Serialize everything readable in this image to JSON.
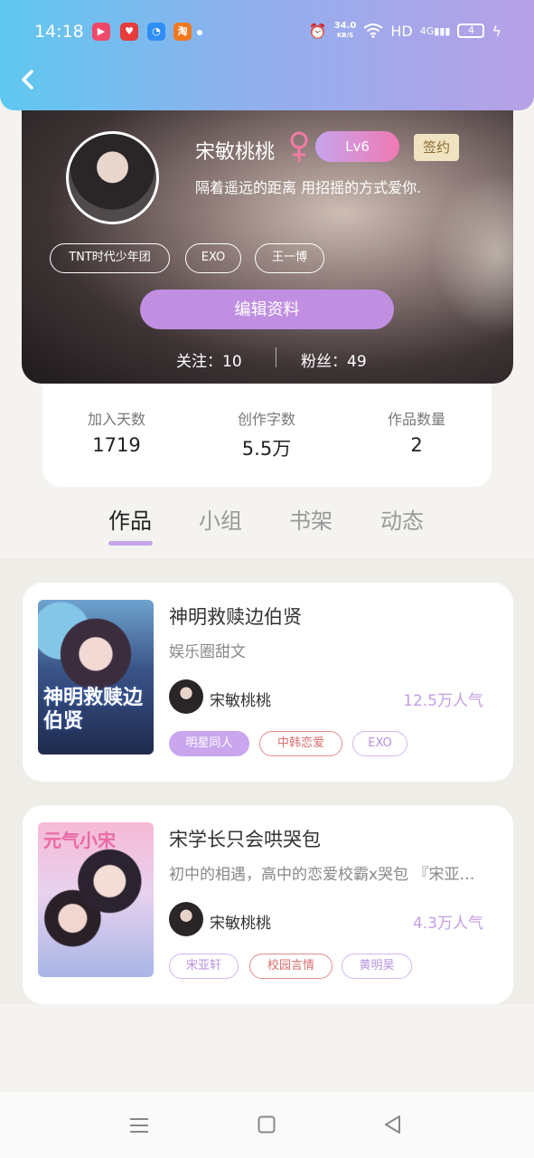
{
  "status_bar": {
    "time": "14:18",
    "net_speed": "34.0",
    "net_unit": "KB/S",
    "hd": "HD",
    "signal": "4G",
    "battery": "4"
  },
  "profile": {
    "name": "宋敏桃桃",
    "level": "Lv6",
    "sign_badge": "签约",
    "bio": "隔着遥远的距离 用招摇的方式爱你.",
    "tags": [
      "TNT时代少年团",
      "EXO",
      "王一博"
    ],
    "edit_button": "编辑资料",
    "following_label": "关注：10",
    "followers_label": "粉丝：49"
  },
  "stats": [
    {
      "label": "加入天数",
      "value": "1719"
    },
    {
      "label": "创作字数",
      "value": "5.5万"
    },
    {
      "label": "作品数量",
      "value": "2"
    }
  ],
  "tabs": [
    {
      "label": "作品",
      "active": true
    },
    {
      "label": "小组",
      "active": false
    },
    {
      "label": "书架",
      "active": false
    },
    {
      "label": "动态",
      "active": false
    }
  ],
  "works": [
    {
      "title": "神明救赎边伯贤",
      "subtitle": "娱乐圈甜文",
      "author": "宋敏桃桃",
      "popularity": "12.5万人气",
      "tags": [
        "明星同人",
        "中韩恋爱",
        "EXO"
      ],
      "cover_text": "神明救赎边伯贤"
    },
    {
      "title": "宋学长只会哄哭包",
      "subtitle": "初中的相遇，高中的恋爱校霸x哭包 『宋亚轩』",
      "author": "宋敏桃桃",
      "popularity": "4.3万人气",
      "tags": [
        "宋亚轩",
        "校园言情",
        "黄明昊"
      ],
      "cover_text": "元气小宋"
    }
  ],
  "colors": {
    "accent": "#c08fe2",
    "header_start": "#5ec8ef",
    "header_end": "#b7a0e6"
  }
}
